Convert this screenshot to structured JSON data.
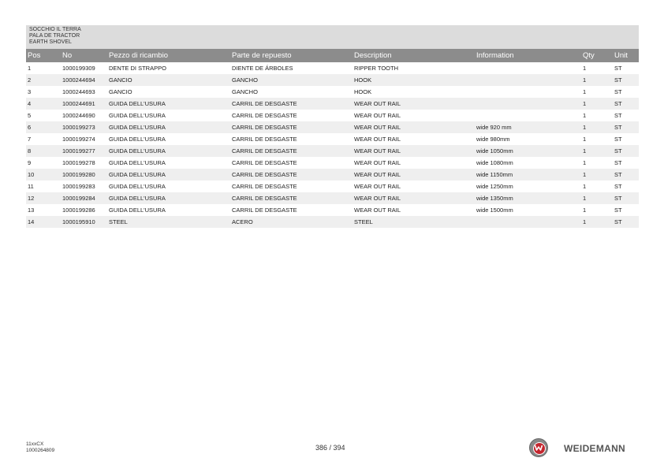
{
  "title": {
    "line1": "SOCCHIO IL TERRA",
    "line2": "PALA DE TRACTOR",
    "line3": "EARTH SHOVEL"
  },
  "headers": {
    "pos": "Pos",
    "no": "No",
    "it": "Pezzo di ricambio",
    "es": "Parte de repuesto",
    "en": "Description",
    "info": "Information",
    "qty": "Qty",
    "unit": "Unit"
  },
  "rows": [
    {
      "pos": "1",
      "no": "1000199309",
      "it": "DENTE DI STRAPPO",
      "es": "DIENTE DE ÁRBOLES",
      "en": "RIPPER TOOTH",
      "info": "",
      "qty": "1",
      "unit": "ST"
    },
    {
      "pos": "2",
      "no": "1000244694",
      "it": "GANCIO",
      "es": "GANCHO",
      "en": "HOOK",
      "info": "",
      "qty": "1",
      "unit": "ST"
    },
    {
      "pos": "3",
      "no": "1000244693",
      "it": "GANCIO",
      "es": "GANCHO",
      "en": "HOOK",
      "info": "",
      "qty": "1",
      "unit": "ST"
    },
    {
      "pos": "4",
      "no": "1000244691",
      "it": "GUIDA DELL'USURA",
      "es": "CARRIL DE DESGASTE",
      "en": "WEAR OUT RAIL",
      "info": "",
      "qty": "1",
      "unit": "ST"
    },
    {
      "pos": "5",
      "no": "1000244690",
      "it": "GUIDA DELL'USURA",
      "es": "CARRIL DE DESGASTE",
      "en": "WEAR OUT RAIL",
      "info": "",
      "qty": "1",
      "unit": "ST"
    },
    {
      "pos": "6",
      "no": "1000199273",
      "it": "GUIDA DELL'USURA",
      "es": "CARRIL DE DESGASTE",
      "en": "WEAR OUT RAIL",
      "info": "wide 920 mm",
      "qty": "1",
      "unit": "ST"
    },
    {
      "pos": "7",
      "no": "1000199274",
      "it": "GUIDA DELL'USURA",
      "es": "CARRIL DE DESGASTE",
      "en": "WEAR OUT RAIL",
      "info": "wide 980mm",
      "qty": "1",
      "unit": "ST"
    },
    {
      "pos": "8",
      "no": "1000199277",
      "it": "GUIDA DELL'USURA",
      "es": "CARRIL DE DESGASTE",
      "en": "WEAR OUT RAIL",
      "info": "wide 1050mm",
      "qty": "1",
      "unit": "ST"
    },
    {
      "pos": "9",
      "no": "1000199278",
      "it": "GUIDA DELL'USURA",
      "es": "CARRIL DE DESGASTE",
      "en": "WEAR OUT RAIL",
      "info": "wide 1080mm",
      "qty": "1",
      "unit": "ST"
    },
    {
      "pos": "10",
      "no": "1000199280",
      "it": "GUIDA DELL'USURA",
      "es": "CARRIL DE DESGASTE",
      "en": "WEAR OUT RAIL",
      "info": "wide 1150mm",
      "qty": "1",
      "unit": "ST"
    },
    {
      "pos": "11",
      "no": "1000199283",
      "it": "GUIDA DELL'USURA",
      "es": "CARRIL DE DESGASTE",
      "en": "WEAR OUT RAIL",
      "info": "wide 1250mm",
      "qty": "1",
      "unit": "ST"
    },
    {
      "pos": "12",
      "no": "1000199284",
      "it": "GUIDA DELL'USURA",
      "es": "CARRIL DE DESGASTE",
      "en": "WEAR OUT RAIL",
      "info": "wide 1350mm",
      "qty": "1",
      "unit": "ST"
    },
    {
      "pos": "13",
      "no": "1000199286",
      "it": "GUIDA DELL'USURA",
      "es": "CARRIL DE DESGASTE",
      "en": "WEAR OUT RAIL",
      "info": "wide 1500mm",
      "qty": "1",
      "unit": "ST"
    },
    {
      "pos": "14",
      "no": "1000195910",
      "it": "STEEL",
      "es": "ACERO",
      "en": "STEEL",
      "info": "",
      "qty": "1",
      "unit": "ST"
    }
  ],
  "footer": {
    "model": "11xxCX",
    "doc_number": "1000264809",
    "page": "386 / 394",
    "brand": "WEIDEMANN"
  },
  "colors": {
    "header_bg": "#8c8c8c",
    "title_bg": "#dcdcdc",
    "row_alt_bg": "#efefef",
    "logo_red": "#c4262e"
  }
}
